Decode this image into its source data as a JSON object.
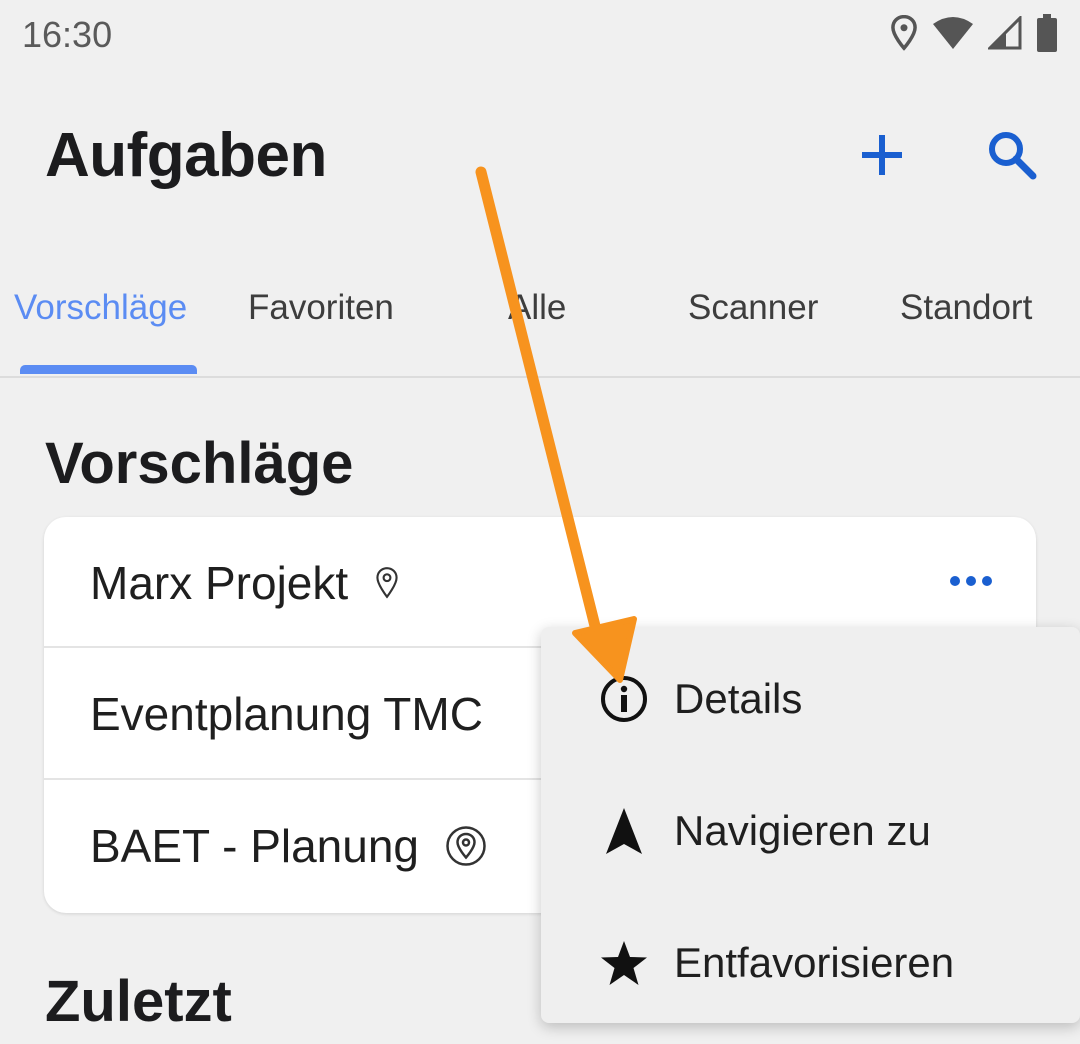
{
  "status_bar": {
    "time": "16:30",
    "icons": [
      "location-icon",
      "wifi-icon",
      "signal-icon",
      "battery-icon"
    ]
  },
  "header": {
    "title": "Aufgaben",
    "actions": [
      "add-icon",
      "search-icon"
    ]
  },
  "tabs": [
    {
      "label": "Vorschläge",
      "active": true
    },
    {
      "label": "Favoriten",
      "active": false
    },
    {
      "label": "Alle",
      "active": false
    },
    {
      "label": "Scanner",
      "active": false
    },
    {
      "label": "Standort",
      "active": false
    }
  ],
  "sections": {
    "suggestions_title": "Vorschläge",
    "recent_title": "Zuletzt"
  },
  "suggestions": [
    {
      "label": "Marx Projekt",
      "icon": "location-pin-outline-icon"
    },
    {
      "label": "Eventplanung TMC",
      "icon": ""
    },
    {
      "label": "BAET - Planung",
      "icon": "location-pin-circle-icon"
    }
  ],
  "context_menu": {
    "items": [
      {
        "label": "Details",
        "icon": "info-icon"
      },
      {
        "label": "Navigieren zu",
        "icon": "navigation-arrow-icon"
      },
      {
        "label": "Entfavorisieren",
        "icon": "star-icon"
      }
    ]
  },
  "colors": {
    "accent": "#5b8cf3",
    "action_blue": "#1a5fd0",
    "annotation_orange": "#f7931e",
    "background": "#f0f0f0"
  }
}
